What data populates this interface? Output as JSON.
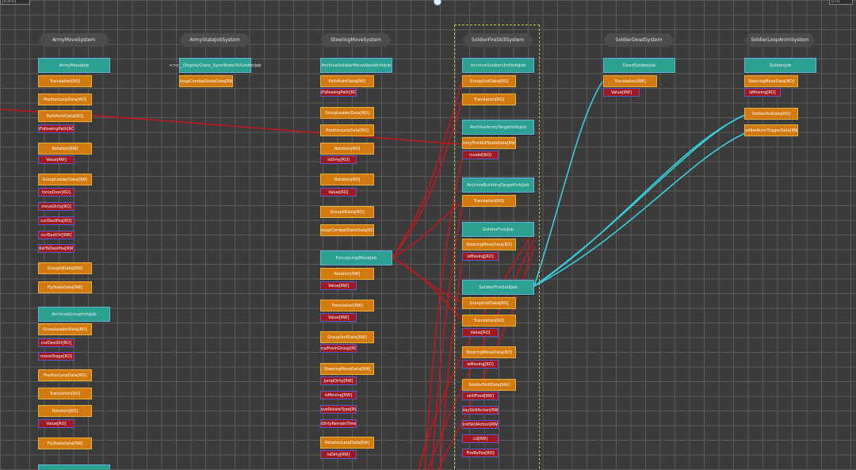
{
  "toolbar": {
    "left_field": "[0-0-0]",
    "right_field": "0.01"
  },
  "colors": {
    "read_only": "#d27a10",
    "read_write": "#9e1a1e",
    "job": "#2aa191",
    "red_link": "#c0181c",
    "cyan_link": "#35d0e0",
    "selection": "#c9c34a"
  },
  "columns": [
    {
      "system": "ArmyMoveSystem",
      "jobs": [
        "ArmyMoveJob",
        "ArchiveGroupInfoJob"
      ],
      "components": [
        "Translation[RO]",
        "Value[RW]",
        "PositionLerpData[RO]",
        "PathPointData[RO]",
        "isFollowingPath[RO]",
        "Rotation[RW]",
        "Value[RW]",
        "GroupLeaderData[RW]",
        "forceOver[RO]",
        "moveDirty[RO]",
        "curDestPos[RO]",
        "curDestDir[RW]",
        "distToDestPos[RW]",
        "GroupIdData[RW]",
        "FlyStateData[RW]",
        "GroupLeaderData[RO]",
        "curDestDir[RO]",
        "moveStage[RO]",
        "PositionLerpData[RO]",
        "Translation[RO]",
        "Rotation[RO]",
        "Value[RO]",
        "FlyStateData[RW]"
      ]
    },
    {
      "system": "ArmyStateJobSystem",
      "jobs": [
        "<>c__DisplayClass_SyncStateToSoldierJob"
      ],
      "components": [
        "GroupCombatStateData[RW]"
      ]
    },
    {
      "system": "SteeringMoveSystem",
      "jobs": [
        "ArchiveSoldierMoveNeedInfoJob",
        "ForceJumpMoveJob"
      ],
      "components": [
        "PathPointData[RO]",
        "isFollowingPath[RO]",
        "GroupLeaderData[RO]",
        "PositionLerpData[RO]",
        "Rotation[RO]",
        "isDirty[RO]",
        "Rotation[RO]",
        "Value[RO]",
        "GroupIdData[RO]",
        "GroupCombatStateData[RO]",
        "Rotation[RW]",
        "Value[RW]",
        "Translation[RW]",
        "Value[RW]",
        "GroupUnitData[RW]",
        "localPosInGroup[RO]",
        "SteeringMoveData[RW]",
        "jumpDirty[RW]",
        "isMoving[RW]",
        "moveRotateType[RW]",
        "moveDirtyRemainTime[RW]",
        "RotationLerpData[RW]",
        "isDirty[RW]"
      ]
    },
    {
      "system": "SoldierFireSkillSystem",
      "jobs": [
        "ArchiveSoldierUnitInfoJob",
        "ArchiveArmyTargetInfoJob",
        "ArchiveBuildingTargetInfoJob",
        "SoldierFsmJob",
        "SoldierFireSkillJob"
      ],
      "components": [
        "GroupUnitData[RO]",
        "Translation[RO]",
        "ArmyFireSkillStateData[RW]",
        "invalid[RO]",
        "Translation[RO]",
        "SteeringMoveData[RO]",
        "isMoving[RO]",
        "GroupUnitData[RO]",
        "Translation[RO]",
        "Value[RO]",
        "SteeringMoveData[RO]",
        "isMoving[RO]",
        "SoldierSkillData[RW]",
        "skillFired[RW]",
        "playSkillAction[RW]",
        "firstSkillAction[RW]",
        "cd[RW]",
        "FireByPos[RO]"
      ]
    },
    {
      "system": "SoldierDeadSystem",
      "jobs": [
        "DeadSoldierJob"
      ],
      "components": [
        "Translation[RW]",
        "Value[RW]"
      ]
    },
    {
      "system": "SoldierLoopAnimSystem",
      "jobs": [
        "SoldierJob"
      ],
      "components": [
        "SteeringMoveData[RO]",
        "isMoving[RO]",
        "SoldierAniData[RO]",
        "SoldierAnimTriggerData[RW]"
      ]
    }
  ]
}
